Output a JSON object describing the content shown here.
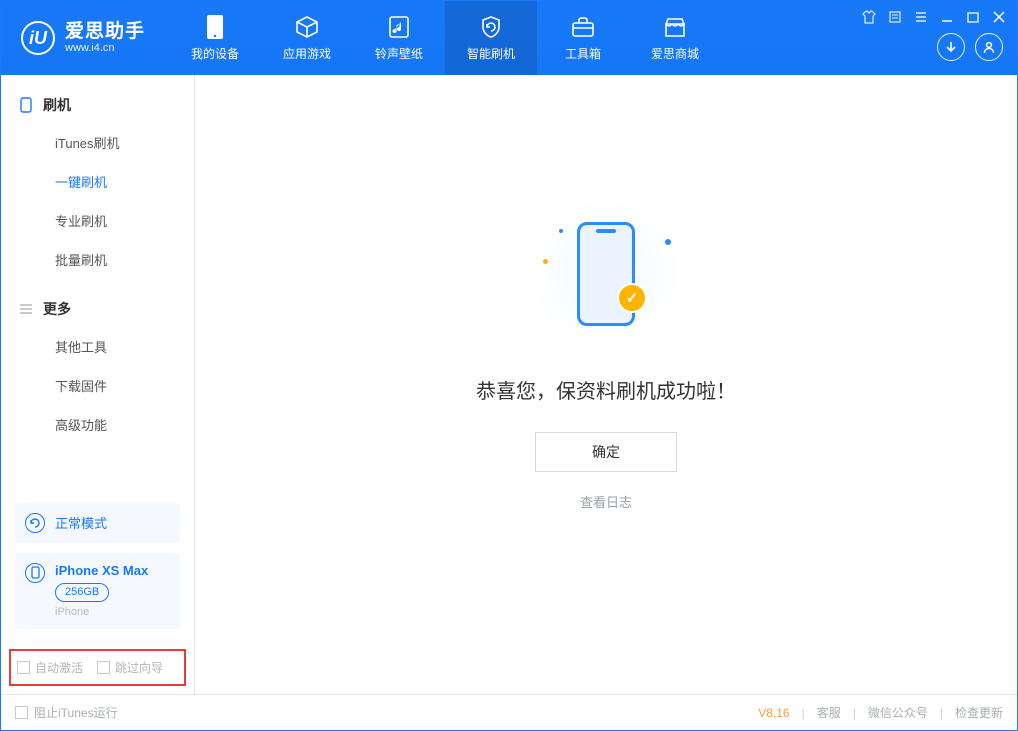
{
  "app": {
    "name": "爱思助手",
    "url": "www.i4.cn"
  },
  "nav": {
    "items": [
      {
        "label": "我的设备"
      },
      {
        "label": "应用游戏"
      },
      {
        "label": "铃声壁纸"
      },
      {
        "label": "智能刷机"
      },
      {
        "label": "工具箱"
      },
      {
        "label": "爱思商城"
      }
    ]
  },
  "sidebar": {
    "group1": {
      "title": "刷机",
      "items": [
        "iTunes刷机",
        "一键刷机",
        "专业刷机",
        "批量刷机"
      ]
    },
    "group2": {
      "title": "更多",
      "items": [
        "其他工具",
        "下载固件",
        "高级功能"
      ]
    },
    "mode": "正常模式",
    "device": {
      "name": "iPhone XS Max",
      "storage": "256GB",
      "type": "iPhone"
    },
    "opt_auto_activate": "自动激活",
    "opt_skip_guide": "跳过向导"
  },
  "main": {
    "message": "恭喜您，保资料刷机成功啦！",
    "confirm": "确定",
    "view_log": "查看日志"
  },
  "status": {
    "block_itunes": "阻止iTunes运行",
    "version": "V8.16",
    "links": [
      "客服",
      "微信公众号",
      "检查更新"
    ]
  }
}
